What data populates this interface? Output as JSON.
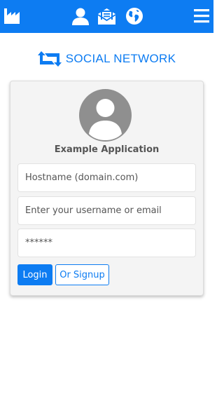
{
  "colors": {
    "accent": "#0d7cf2",
    "card_bg": "#f4f4f4",
    "avatar": "#8f8f8f"
  },
  "topbar": {
    "icons": [
      "factory-icon",
      "user-icon",
      "mail-open-icon",
      "globe-icon",
      "hamburger-menu-icon"
    ]
  },
  "brand": {
    "name": "SOCIAL NETWORK",
    "logo_icon": "retweet-icon"
  },
  "login_card": {
    "avatar_icon": "user-avatar-icon",
    "app_name": "Example Application",
    "fields": {
      "hostname_placeholder": "Hostname (domain.com)",
      "username_placeholder": "Enter your username or email",
      "password_placeholder": "******"
    },
    "buttons": {
      "login": "Login",
      "signup": "Or Signup"
    }
  }
}
